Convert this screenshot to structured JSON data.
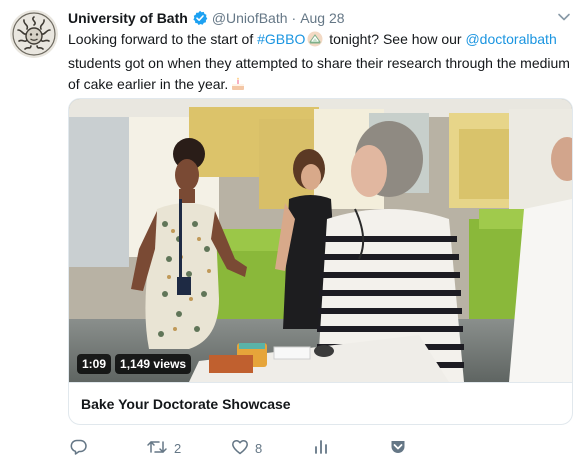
{
  "author": {
    "name": "University of Bath",
    "handle": "@UniofBath",
    "separator": "·",
    "time": "Aug 28",
    "verified": true,
    "avatar_icon": "university-crest-icon"
  },
  "tweet": {
    "segment_1": "Looking forward to the start of ",
    "hashtag": "#GBBO",
    "segment_2": " tonight? See how our ",
    "mention": "@doctoralbath",
    "segment_3": " students got on when they attempted to share their research through the medium of cake earlier in the year.",
    "emoji_1": "gbbo-tent-emoji",
    "emoji_2": "cake-emoji"
  },
  "video": {
    "duration": "1:09",
    "views": "1,149 views",
    "title": "Bake Your Doctorate Showcase"
  },
  "actions": {
    "reply_count": "",
    "retweet_count": "2",
    "like_count": "8",
    "icons": [
      "reply-icon",
      "retweet-icon",
      "like-icon",
      "analytics-icon",
      "share-icon"
    ]
  },
  "colors": {
    "link": "#1b95e0",
    "text": "#14171a",
    "secondary": "#657786",
    "border": "#e1e8ed",
    "verified": "#1da1f2"
  }
}
